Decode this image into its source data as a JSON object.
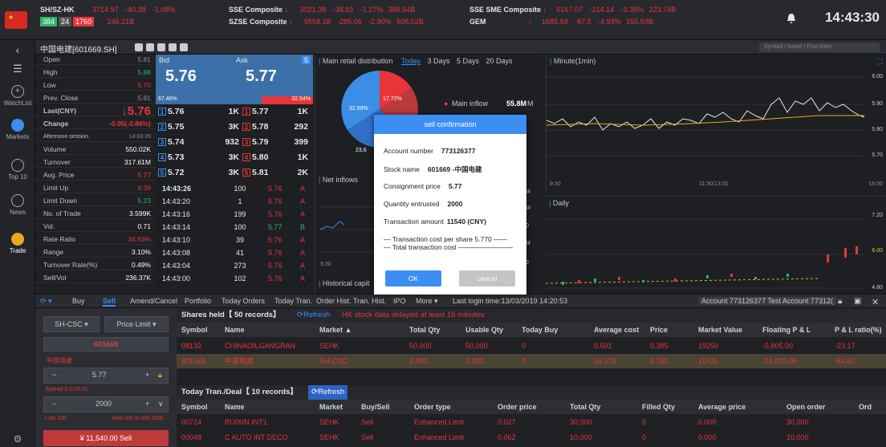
{
  "topbar": {
    "market": {
      "name": "SH/SZ-HK",
      "value": "3714.97",
      "chg": "-40.38",
      "pct": "-1.08%",
      "up": "384",
      "flat": "24",
      "down": "1760",
      "amount": "246.21B"
    },
    "sse": {
      "name": "SSE Composite",
      "value": "3021.38",
      "chg": "-38.93",
      "pct": "-1.27%",
      "amount": "385.64B"
    },
    "szse": {
      "name": "SZSE Composite",
      "value": "9558.18",
      "chg": "-285.06",
      "pct": "-2.90%",
      "amount": "508.02B"
    },
    "sme": {
      "name": "SSE SME Composite",
      "value": "6167.07",
      "chg": "-214.14",
      "pct": "-3.35%",
      "amount": "223.74B"
    },
    "gem": {
      "name": "GEM",
      "value": "1685.93",
      "chg": "-87.5",
      "pct": "-4.93%",
      "amount": "155.59B"
    },
    "time": "14:43:30"
  },
  "nav": [
    {
      "label": "WatchList",
      "icon": "plus-circle-icon"
    },
    {
      "label": "Markets",
      "icon": "chart-icon"
    },
    {
      "label": "Top 10",
      "icon": "top-icon"
    },
    {
      "label": "News",
      "icon": "news-icon"
    },
    {
      "label": "Trade",
      "icon": "trade-icon"
    }
  ],
  "title": {
    "stock": "中国电建[601669.SH]",
    "search_placeholder": "Symbol / Name / First letter"
  },
  "quote": [
    {
      "k": "Open",
      "v": "5.81",
      "c": "gry"
    },
    {
      "k": "High",
      "v": "5.88",
      "c": "grn"
    },
    {
      "k": "Low",
      "v": "5.70",
      "c": "red"
    },
    {
      "k": "Prev. Close",
      "v": "5.81",
      "c": "gry"
    },
    {
      "k": "Last(CNY)",
      "v": "↓5.76",
      "c": "red",
      "big": true
    },
    {
      "k": "Change",
      "v": "-0.05(-0.86%)",
      "c": "red",
      "bold": true
    },
    {
      "k": "Afternoon session",
      "v": "14:43:26",
      "c": "gry",
      "small": true
    },
    {
      "k": "Volume",
      "v": "550.02K",
      "c": "wht"
    },
    {
      "k": "Turnover",
      "v": "317.61M",
      "c": "wht"
    },
    {
      "k": "Avg. Price",
      "v": "5.77",
      "c": "red"
    },
    {
      "k": "Limit Up",
      "v": "6.39",
      "c": "red"
    },
    {
      "k": "Limit Down",
      "v": "5.23",
      "c": "grn"
    },
    {
      "k": "No. of Trade",
      "v": "3.599K",
      "c": "wht"
    },
    {
      "k": "Vol.",
      "v": "0.71",
      "c": "wht"
    },
    {
      "k": "Rate Ratio",
      "v": "34.93%",
      "c": "red"
    },
    {
      "k": "Range",
      "v": "3.10%",
      "c": "wht"
    },
    {
      "k": "Turnover Rate(%)",
      "v": "0.49%",
      "c": "wht"
    },
    {
      "k": "Sell/Vol",
      "v": "236.37K",
      "c": "wht"
    }
  ],
  "bidask": {
    "bid_label": "Bid",
    "ask_label": "Ask",
    "bid": "5.76",
    "ask": "5.77",
    "ask_idx": "5",
    "bid_pct": "67.46%",
    "ask_pct": "32.54%",
    "bid_pct_value": 0.6746,
    "levels": [
      {
        "n": "1",
        "b": "5.76",
        "bv": "1K",
        "a": "5.77",
        "av": "1K"
      },
      {
        "n": "2",
        "b": "5.75",
        "bv": "3K",
        "a": "5.78",
        "av": "292"
      },
      {
        "n": "3",
        "b": "5.74",
        "bv": "932",
        "a": "5.79",
        "av": "399"
      },
      {
        "n": "4",
        "b": "5.73",
        "bv": "3K",
        "a": "5.80",
        "av": "1K"
      },
      {
        "n": "5",
        "b": "5.72",
        "bv": "3K",
        "a": "5.81",
        "av": "2K"
      }
    ],
    "trades": [
      {
        "t": "14:43:26",
        "v": "100",
        "p": "5.76",
        "s": "A"
      },
      {
        "t": "14:43:20",
        "v": "1",
        "p": "5.76",
        "s": "A"
      },
      {
        "t": "14:43:16",
        "v": "199",
        "p": "5.76",
        "s": "A"
      },
      {
        "t": "14:43:14",
        "v": "100",
        "p": "5.77",
        "s": "B"
      },
      {
        "t": "14:43:10",
        "v": "39",
        "p": "5.76",
        "s": "A"
      },
      {
        "t": "14:43:08",
        "v": "41",
        "p": "5.76",
        "s": "A"
      },
      {
        "t": "14:43:04",
        "v": "273",
        "p": "5.76",
        "s": "A"
      },
      {
        "t": "14:43:00",
        "v": "102",
        "p": "5.76",
        "s": "A"
      }
    ]
  },
  "retail": {
    "title": "Main retail distribution",
    "tabs": [
      "Today",
      "3 Days",
      "5 Days",
      "20 Days"
    ],
    "pie_a": "32.99%",
    "pie_b": "17.72%",
    "pie_c": "23.6",
    "main_inflow_label": "Main inflow",
    "main_inflow": "55.8M",
    "net_inflows": "Net inflows",
    "historical": "Historical capit",
    "t930": "9:30",
    "r8m": "8M",
    "r4m": "4M",
    "r0": "0",
    "r4mb": "4M",
    "r00": "00"
  },
  "minute": {
    "title": "Minute(1min)",
    "y": [
      "6.00",
      "5.90",
      "5.80",
      "5.70"
    ],
    "x": [
      "9:30",
      "11:30/13:00",
      "15:00"
    ],
    "daily": "Daily",
    "dy": [
      "7.20",
      "6.00",
      "4.80"
    ]
  },
  "tabs": [
    "Buy",
    "Sell",
    "Amend/Cancel",
    "Portfolio",
    "Today Orders",
    "Today Tran.",
    "Order Hist.",
    "Tran. Hist.",
    "IPO",
    "More"
  ],
  "last_login": "Last login time:13/03/2019 14:20:53",
  "account": "Account  773126377 Test Account 77312(",
  "order": {
    "market": "SH-CSC",
    "type": "Price Limit",
    "code": "601669",
    "name": "中国电建",
    "price": "5.77",
    "spread": "Spread 0.01/0.01",
    "qty": "2000",
    "lots": "Lots 100",
    "maxlots": "Max lots to sell 2000",
    "submit": "¥ 11,540.00   Sell"
  },
  "holdings": {
    "title": "Shares held【 50 records】",
    "refresh": "Refresh",
    "note": "HK stock data delayed at least 15 minutes",
    "cols": [
      "Symbol",
      "Name",
      "Market ▲",
      "Total Qty",
      "Usable Qty",
      "Today Buy",
      "Average cost",
      "Price",
      "Market Value",
      "Floating P & L",
      "P & L ratio(%)"
    ],
    "rows": [
      [
        "08132",
        "CHINAOILGANGRAN",
        "SEHK",
        "50,000",
        "50,000",
        "0",
        "0.501",
        "0.385",
        "19250",
        "-5,805.00",
        "-23.17"
      ],
      [
        "601669",
        "中国电建",
        "SH-CSC",
        "2,000",
        "2,000",
        "0",
        "16.270",
        "5.760",
        "11520",
        "-21,020.00",
        "-64.60"
      ]
    ]
  },
  "deals": {
    "title": "Today Tran./Deal【 10 records】",
    "refresh": "Refresh",
    "cols": [
      "Symbol",
      "Name",
      "Market",
      "Buy/Sell",
      "Order type",
      "Order price",
      "Total Qty",
      "Filled Qty",
      "Average price",
      "Open order",
      "Ord"
    ],
    "rows": [
      [
        "00724",
        "RUIXIN INT'L",
        "SEHK",
        "Sell",
        "Enhanced Limit",
        "0.027",
        "30,000",
        "0",
        "0.000",
        "30,000",
        ""
      ],
      [
        "00048",
        "C AUTO INT DECO",
        "SEHK",
        "Sell",
        "Enhanced Limit",
        "0.062",
        "10,000",
        "0",
        "0.000",
        "10,000",
        ""
      ]
    ]
  },
  "dialog": {
    "title": "sell confirmation",
    "account_label": "Account number",
    "account": "773126377",
    "stock_label": "Stock name",
    "stock": "601669 -中国电建",
    "price_label": "Consignment price",
    "price": "5.77",
    "qty_label": "Quantity entrusted",
    "qty": "2000",
    "amount_label": "Transaction amount",
    "amount": "11540 (CNY)",
    "cost_share": "Transaction cost per share 5.770",
    "cost_total": "Total transaction cost",
    "ok": "OK",
    "cancel": "cancel"
  }
}
